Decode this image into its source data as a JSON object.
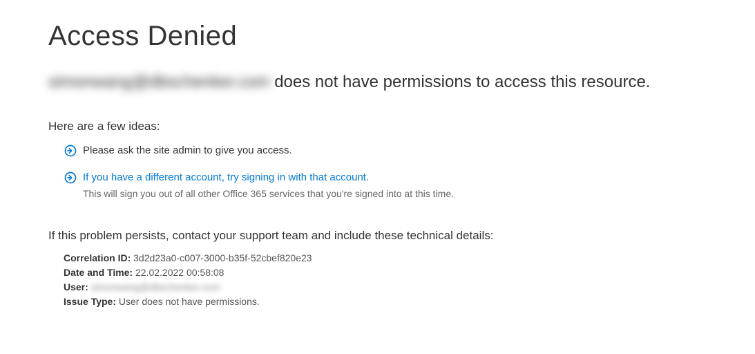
{
  "title": "Access Denied",
  "message": {
    "email_prefix_blurred": "simonwang",
    "email_domain_blurred": "@dbschenker.com",
    "suffix": " does not have permissions to access this resource."
  },
  "ideas_heading": "Here are a few ideas:",
  "ideas": [
    {
      "text": "Please ask the site admin to give you access.",
      "is_link": false,
      "subtext": null
    },
    {
      "text": "If you have a different account, try signing in with that account.",
      "is_link": true,
      "subtext": "This will sign you out of all other Office 365 services that you're signed into at this time."
    }
  ],
  "tech_heading": "If this problem persists, contact your support team and include these technical details:",
  "tech": {
    "correlation_id_label": "Correlation ID:",
    "correlation_id": "3d2d23a0-c007-3000-b35f-52cbef820e23",
    "date_time_label": "Date and Time:",
    "date_time": "22.02.2022 00:58:08",
    "user_label": "User:",
    "user_blurred": "simonwang@dbschenker.com",
    "issue_type_label": "Issue Type:",
    "issue_type": "User does not have permissions."
  },
  "icon_color": "#0078d4"
}
